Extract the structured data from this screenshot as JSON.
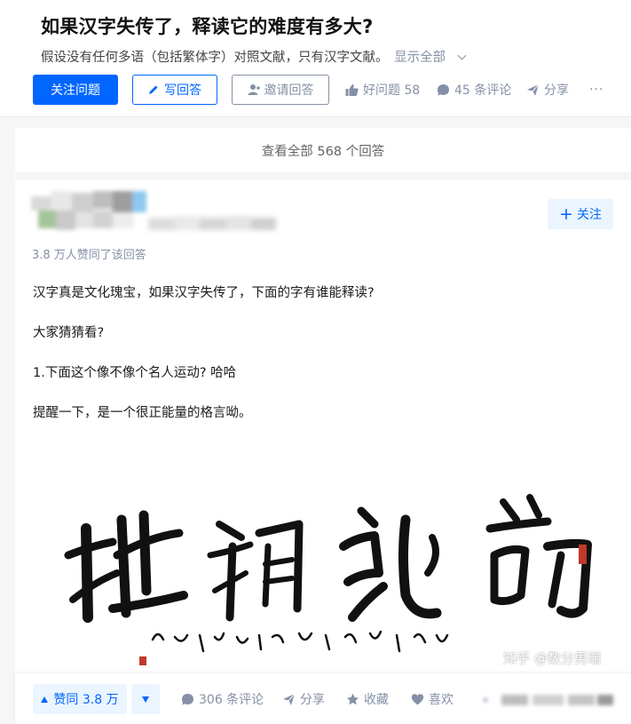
{
  "question": {
    "title": "如果汉字失传了，释读它的难度有多大?",
    "detail": "假设没有任何多语（包括繁体字）对照文献，只有汉字文献。",
    "show_all": "显示全部",
    "follow_label": "关注问题",
    "write_label": "写回答",
    "invite_label": "邀请回答",
    "good_question": "好问题 58",
    "comments": "45 条评论",
    "share": "分享",
    "more": "···"
  },
  "all_answers_label": "查看全部 568 个回答",
  "answer": {
    "follow_label": "关注",
    "votes_line": "3.8 万人赞同了该回答",
    "paragraphs": [
      "汉字真是文化瑰宝，如果汉字失传了，下面的字有谁能释读?",
      "大家猜猜看?",
      "1.下面这个像不像个名人运动? 哈哈",
      "提醒一下，是一个很正能量的格言呦。"
    ],
    "watermark": "知乎 @数分男瑞"
  },
  "bottom_bar": {
    "upvote_label": "赞同 3.8 万",
    "comments": "306 条评论",
    "share": "分享",
    "collect": "收藏",
    "like": "喜欢"
  },
  "colors": {
    "brand": "#0066ff",
    "meta": "#8590a6",
    "light_blue": "#ebf5ff"
  }
}
